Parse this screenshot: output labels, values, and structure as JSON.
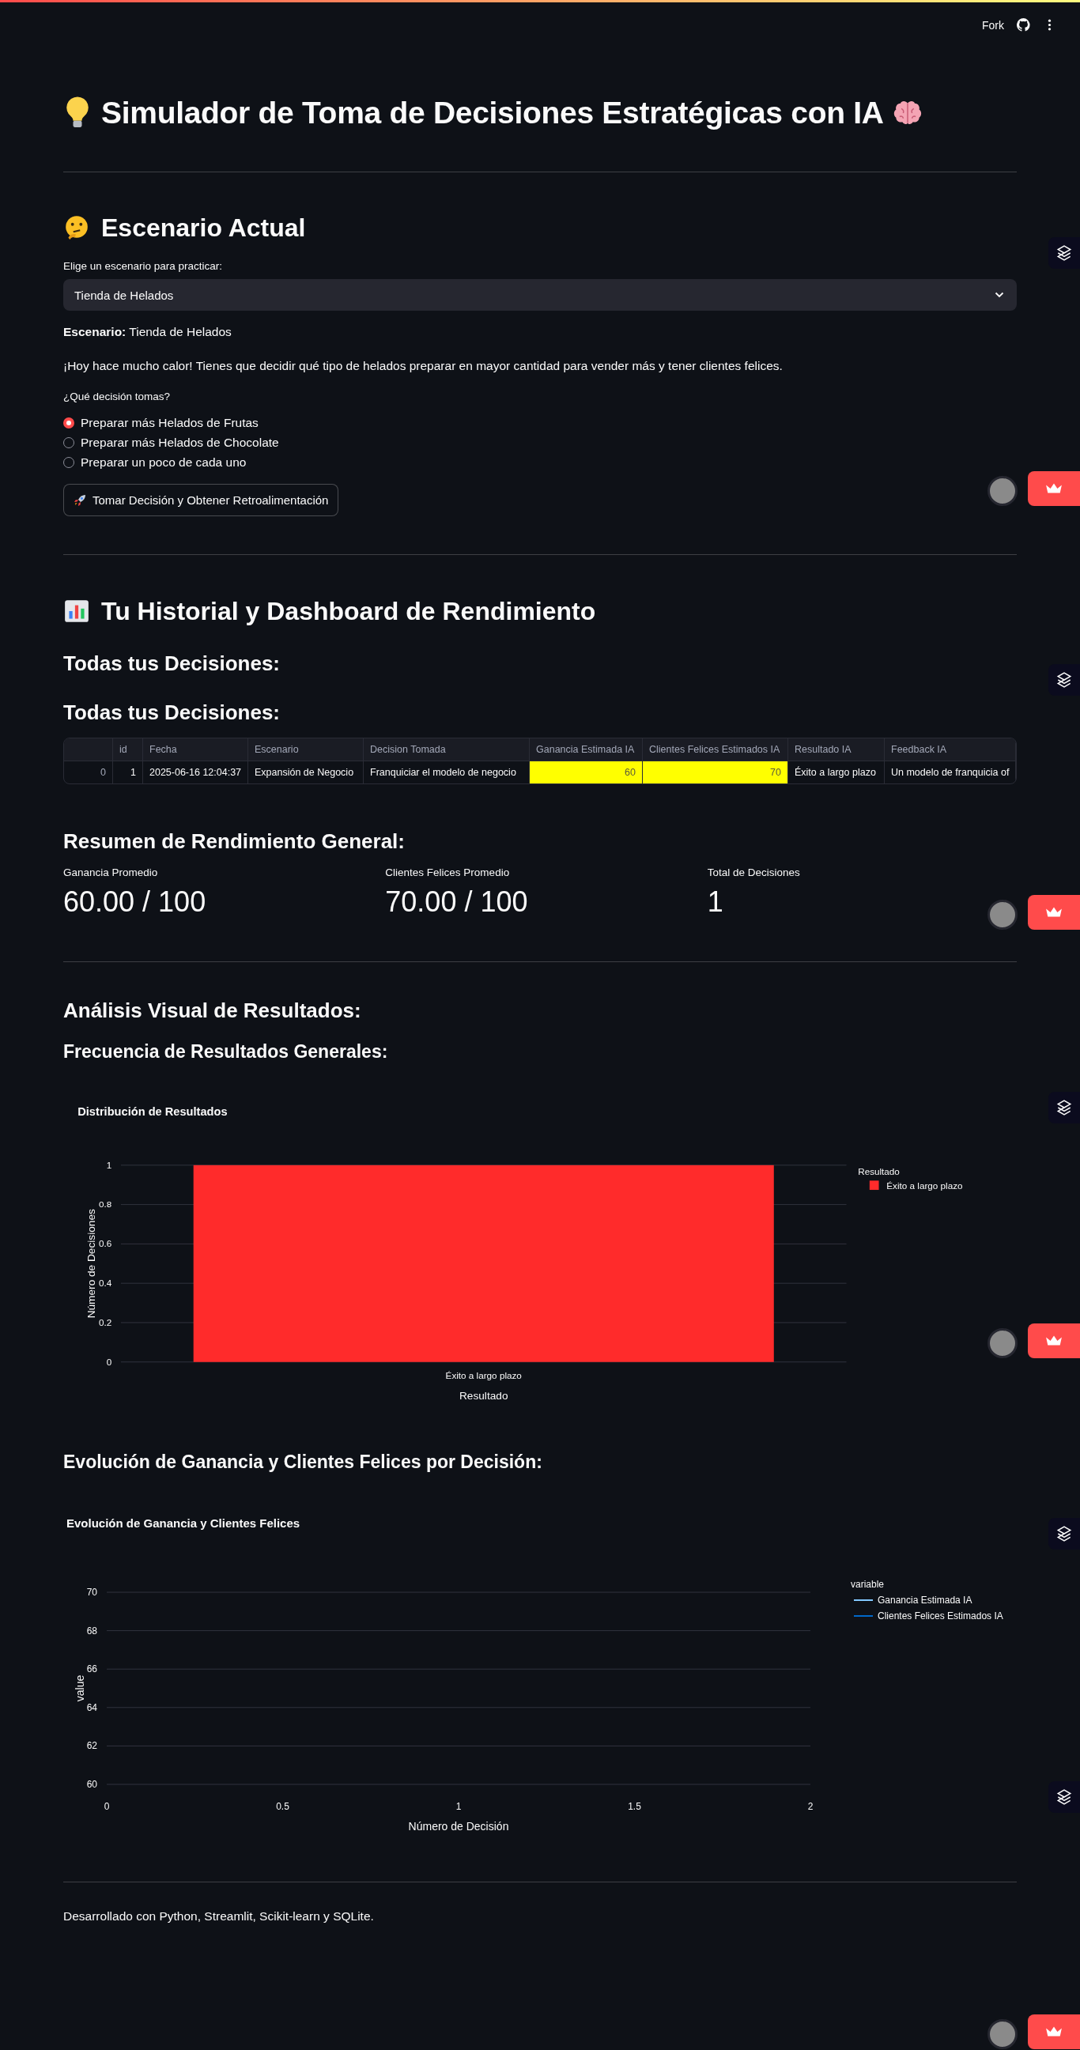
{
  "header": {
    "fork_label": "Fork"
  },
  "title": "Simulador de Toma de Decisiones Estratégicas con IA",
  "scenario_section": {
    "heading": "Escenario Actual",
    "select": {
      "label": "Elige un escenario para practicar:",
      "value": "Tienda de Helados"
    },
    "description": "**Escenario:** Tienda de Helados",
    "prompt": "¡Hoy hace mucho calor! Tienes que decidir qué tipo de helados preparar en mayor cantidad para vender más y tener clientes felices.",
    "question": "¿Qué decisión tomas?",
    "options": [
      {
        "label": "Preparar más Helados de Frutas",
        "selected": true
      },
      {
        "label": "Preparar más Helados de Chocolate",
        "selected": false
      },
      {
        "label": "Preparar un poco de cada uno",
        "selected": false
      }
    ],
    "submit_button": "Tomar Decisión y Obtener Retroalimentación"
  },
  "history_section": {
    "heading": "Tu Historial y Dashboard de Rendimiento",
    "subheadings": [
      "Todas tus Decisiones:",
      "Todas tus Decisiones:"
    ],
    "table": {
      "columns": [
        "id",
        "Fecha",
        "Escenario",
        "Decision Tomada",
        "Ganancia Estimada IA",
        "Clientes Felices Estimados IA",
        "Resultado IA",
        "Feedback IA"
      ],
      "rows": [
        {
          "index": "0",
          "cells": [
            {
              "text": "1",
              "kind": "number",
              "highlighted": false
            },
            {
              "text": "2025-06-16 12:04:37",
              "kind": "text",
              "highlighted": false
            },
            {
              "text": "Expansión de Negocio",
              "kind": "text",
              "highlighted": false
            },
            {
              "text": "Franquiciar el modelo de negocio",
              "kind": "text",
              "highlighted": false
            },
            {
              "text": "60",
              "kind": "number",
              "highlighted": true
            },
            {
              "text": "70",
              "kind": "number",
              "highlighted": true
            },
            {
              "text": "Éxito a largo plazo",
              "kind": "text",
              "highlighted": false
            },
            {
              "text": "Un modelo de franquicia of",
              "kind": "text",
              "highlighted": false
            }
          ]
        }
      ]
    },
    "summary_heading": "Resumen de Rendimiento General:",
    "metrics": [
      {
        "label": "Ganancia Promedio",
        "value": "60.00 / 100"
      },
      {
        "label": "Clientes Felices Promedio",
        "value": "70.00 / 100"
      },
      {
        "label": "Total de Decisiones",
        "value": "1"
      }
    ]
  },
  "analysis_section": {
    "heading": "Análisis Visual de Resultados:",
    "distribution": {
      "heading": "Frecuencia de Resultados Generales:",
      "chart_title": "Distribución de Resultados",
      "x_axis_title": "Resultado",
      "legend_title": "Resultado",
      "chart_data": {
        "type": "bar",
        "ylabel": "Número de Decisiones",
        "categories": [
          "Éxito a largo plazo"
        ],
        "series": [
          {
            "name": "Éxito a largo plazo",
            "color": "#ff2b2b",
            "values": [
              1
            ]
          }
        ],
        "ylim": [
          0,
          1
        ],
        "yticks": [
          0,
          0.2,
          0.4,
          0.6,
          0.8,
          1
        ],
        "grid": true
      }
    },
    "evolution": {
      "heading": "Evolución de Ganancia y Clientes Felices por Decisión:",
      "chart_title": "Evolución de Ganancia y Clientes Felices",
      "x_axis_title": "Número de Decisión",
      "x_axis_ticks": [
        "0",
        "0.5",
        "1",
        "1.5",
        "2"
      ],
      "legend_title": "variable",
      "chart_data": {
        "type": "line",
        "ylabel": "value",
        "series": [
          {
            "name": "Ganancia Estimada IA",
            "color": "#83c9ff"
          },
          {
            "name": "Clientes Felices Estimados IA",
            "color": "#0068c9"
          }
        ],
        "ylim": [
          60,
          70
        ],
        "yticks": [
          60,
          62,
          64,
          66,
          68,
          70
        ],
        "grid": true
      }
    }
  },
  "footer": "Desarrollado con Python, Streamlit, Scikit-learn y SQLite."
}
